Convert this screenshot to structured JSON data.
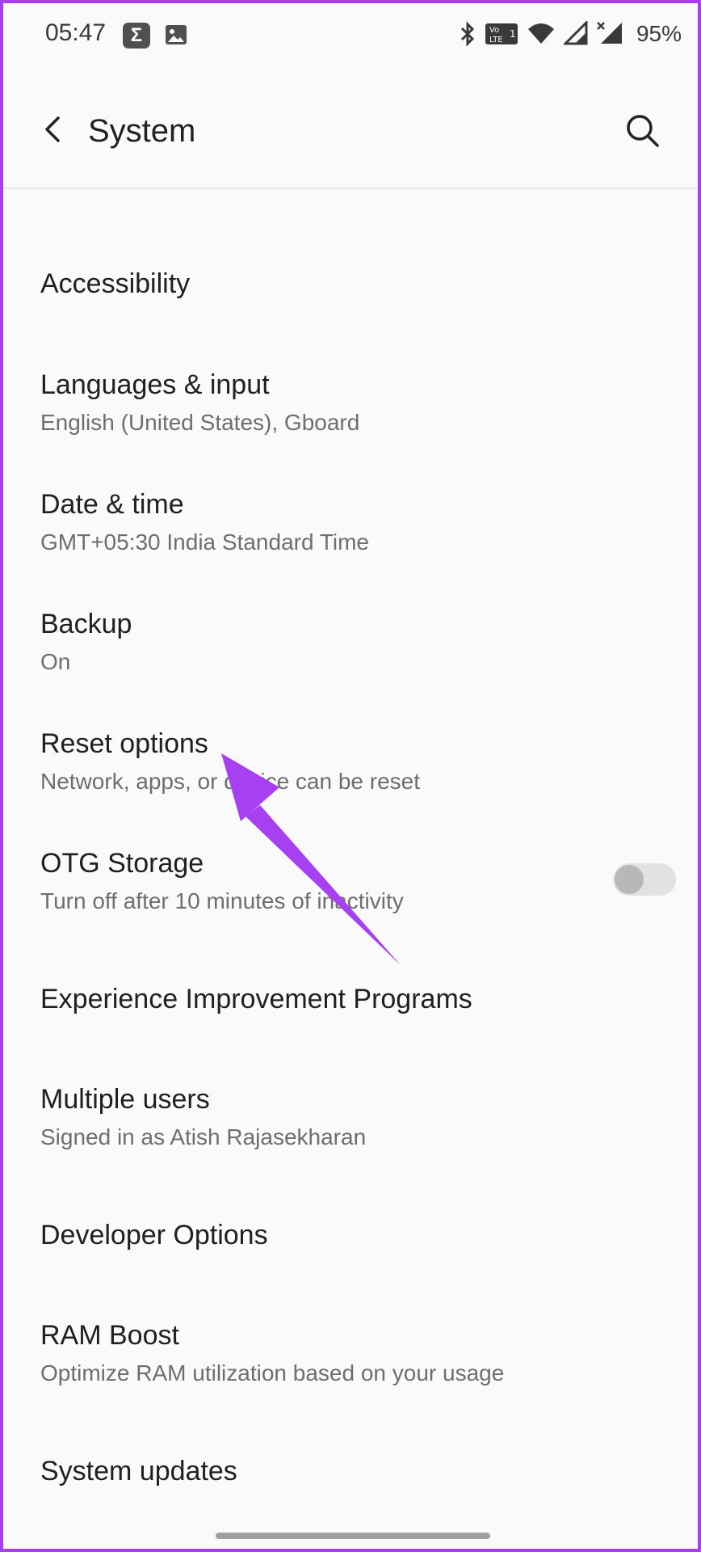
{
  "status_bar": {
    "time": "05:47",
    "sigma_badge": "Σ",
    "volte_badge": "Vo LTE 1",
    "battery": "95%"
  },
  "app_bar": {
    "title": "System"
  },
  "items": [
    {
      "title": "Accessibility",
      "subtitle": ""
    },
    {
      "title": "Languages & input",
      "subtitle": "English (United States), Gboard"
    },
    {
      "title": "Date & time",
      "subtitle": "GMT+05:30 India Standard Time"
    },
    {
      "title": "Backup",
      "subtitle": "On"
    },
    {
      "title": "Reset options",
      "subtitle": "Network, apps, or device can be reset"
    },
    {
      "title": "OTG Storage",
      "subtitle": "Turn off after 10 minutes of inactivity"
    },
    {
      "title": "Experience Improvement Programs",
      "subtitle": ""
    },
    {
      "title": "Multiple users",
      "subtitle": "Signed in as Atish Rajasekharan"
    },
    {
      "title": "Developer Options",
      "subtitle": ""
    },
    {
      "title": "RAM Boost",
      "subtitle": "Optimize RAM utilization based on your usage"
    },
    {
      "title": "System updates",
      "subtitle": ""
    }
  ],
  "otg_toggle": {
    "on": false
  },
  "colors": {
    "frame_border": "#a640f0",
    "annotation_arrow": "#a640f0",
    "background": "#fafafa"
  },
  "icons": {
    "back": "arrow-left-icon",
    "search": "search-icon",
    "bluetooth": "bluetooth-icon",
    "wifi": "wifi-icon",
    "signal": "signal-icon",
    "gallery": "image-icon"
  }
}
